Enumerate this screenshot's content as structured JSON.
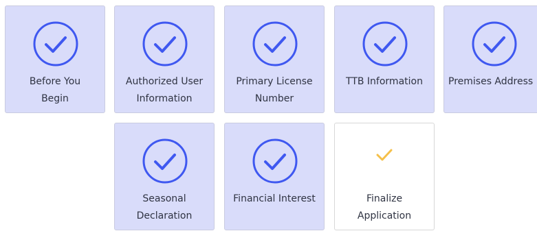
{
  "colors": {
    "completed_background": "#d9dcfa",
    "check_blue": "#3f58f0",
    "pending_check": "#f5c04a",
    "text": "#2f3342"
  },
  "steps": [
    {
      "label": "Before You\nBegin",
      "status": "complete",
      "icon": "check-circle-icon"
    },
    {
      "label": "Authorized User\nInformation",
      "status": "complete",
      "icon": "check-circle-icon"
    },
    {
      "label": "Primary License\nNumber",
      "status": "complete",
      "icon": "check-circle-icon"
    },
    {
      "label": "TTB Information",
      "status": "complete",
      "icon": "check-circle-icon"
    },
    {
      "label": "Premises Address",
      "status": "complete",
      "icon": "check-circle-icon"
    },
    {
      "label": "Seasonal\nDeclaration",
      "status": "complete",
      "icon": "check-circle-icon"
    },
    {
      "label": "Financial Interest",
      "status": "complete",
      "icon": "check-circle-icon"
    },
    {
      "label": "Finalize\nApplication",
      "status": "current",
      "icon": "checkmark-icon"
    }
  ]
}
